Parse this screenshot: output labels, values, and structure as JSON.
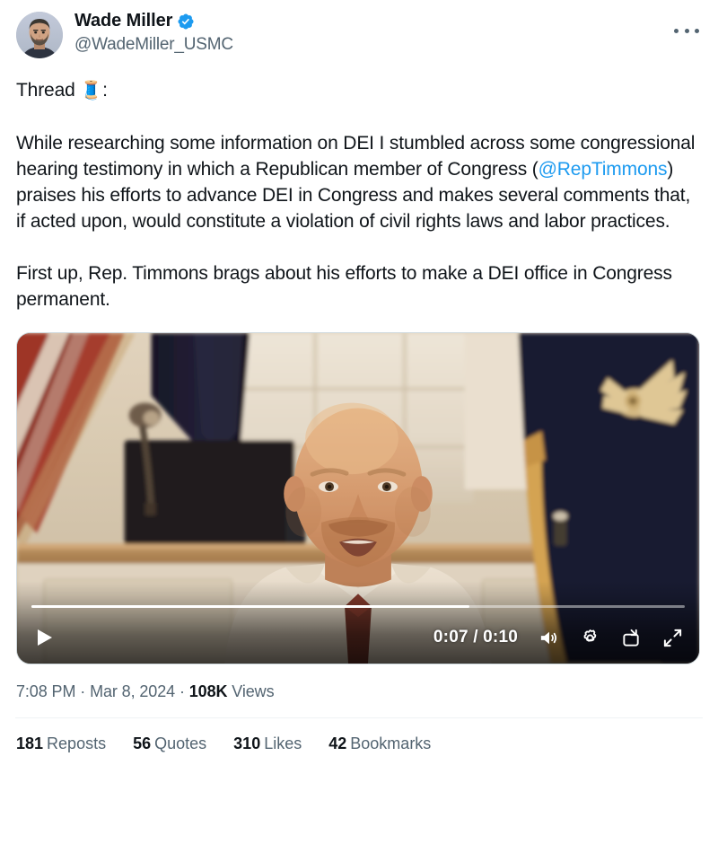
{
  "author": {
    "display_name": "Wade Miller",
    "handle": "@WadeMiller_USMC",
    "verified": true,
    "verified_badge_color": "#1d9bf0",
    "avatar_icon": "user-avatar-photo"
  },
  "more_menu": {
    "icon": "more-horizontal-icon"
  },
  "post": {
    "paragraphs": [
      {
        "id": "p1",
        "segments": [
          {
            "type": "text",
            "text": "Thread "
          },
          {
            "type": "emoji",
            "text": "🧵"
          },
          {
            "type": "text",
            "text": ":"
          }
        ]
      },
      {
        "id": "p2",
        "segments": [
          {
            "type": "text",
            "text": "While researching some information on DEI I stumbled across some congressional hearing testimony in which a Republican member of Congress ("
          },
          {
            "type": "mention",
            "text": "@RepTimmons"
          },
          {
            "type": "text",
            "text": ") praises his efforts to advance DEI in Congress and makes several comments that, if acted upon, would constitute a violation of civil rights laws and labor practices."
          }
        ]
      },
      {
        "id": "p3",
        "segments": [
          {
            "type": "text",
            "text": "First up, Rep. Timmons brags about his efforts to make a DEI office in Congress permanent."
          }
        ]
      }
    ]
  },
  "video": {
    "current_time": "0:07",
    "duration": "0:10",
    "time_display": "0:07 / 0:10",
    "progress_percent": 67,
    "play_icon": "play-icon",
    "volume_icon": "volume-on-icon",
    "settings_icon": "gear-icon",
    "pip_icon": "picture-in-picture-icon",
    "fullscreen_icon": "expand-icon",
    "scene_description": "man-speaking-at-desk-with-flags"
  },
  "meta": {
    "time": "7:08 PM",
    "separator_1": "·",
    "date": "Mar 8, 2024",
    "separator_2": "·",
    "views_count": "108K",
    "views_label": "Views"
  },
  "stats": [
    {
      "name": "reposts",
      "count": "181",
      "label": "Reposts"
    },
    {
      "name": "quotes",
      "count": "56",
      "label": "Quotes"
    },
    {
      "name": "likes",
      "count": "310",
      "label": "Likes"
    },
    {
      "name": "bookmarks",
      "count": "42",
      "label": "Bookmarks"
    }
  ],
  "colors": {
    "accent": "#1d9bf0",
    "text_primary": "#0f1419",
    "text_secondary": "#536471",
    "divider": "#eff3f4",
    "background": "#ffffff"
  }
}
